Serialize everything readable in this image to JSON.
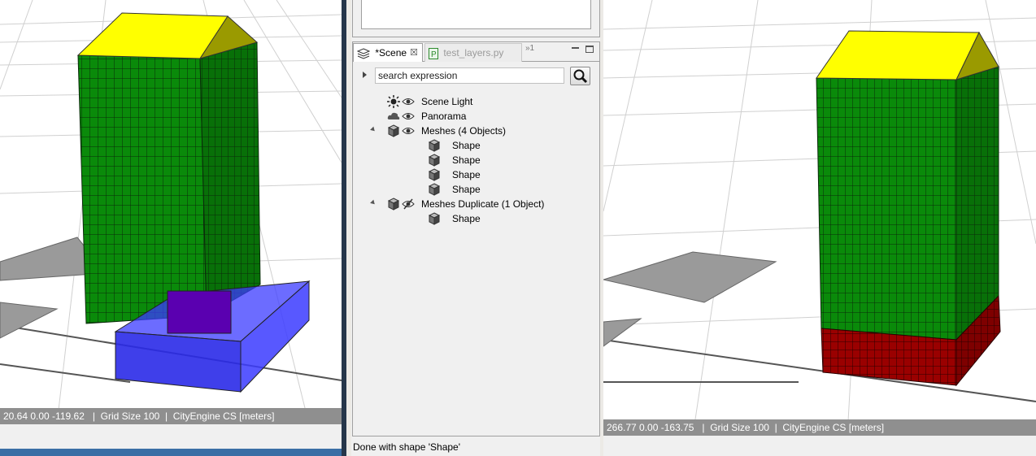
{
  "left_viewport": {
    "status_text": "20.64 0.00 -119.62   |  Grid Size 100  |  CityEngine CS [meters]"
  },
  "right_viewport": {
    "status_text": "266.77 0.00 -163.75   |  Grid Size 100  |  CityEngine CS [meters]"
  },
  "scene_panel": {
    "tabs": [
      {
        "label": "*Scene",
        "icon": "layers-icon",
        "active": true
      },
      {
        "label": "test_layers.py",
        "icon": "python-file-icon",
        "active": false
      }
    ],
    "overflow_label": "»1",
    "search": {
      "placeholder": "search expression",
      "value": "search expression"
    },
    "tree": [
      {
        "label": "Scene Light",
        "icon": "sun-icon",
        "visibility_icon": "eye-icon",
        "level": 0,
        "expandable": false
      },
      {
        "label": "Panorama",
        "icon": "cloud-icon",
        "visibility_icon": "eye-icon",
        "level": 0,
        "expandable": false
      },
      {
        "label": "Meshes (4 Objects)",
        "icon": "mesh-layer-icon",
        "visibility_icon": "eye-icon",
        "level": 0,
        "expandable": true,
        "expanded": true
      },
      {
        "label": "Shape",
        "icon": "cube-icon",
        "level": 1
      },
      {
        "label": "Shape",
        "icon": "cube-icon",
        "level": 1
      },
      {
        "label": "Shape",
        "icon": "cube-icon",
        "level": 1
      },
      {
        "label": "Shape",
        "icon": "cube-icon",
        "level": 1
      },
      {
        "label": "Meshes Duplicate (1 Object)",
        "icon": "mesh-layer-icon",
        "visibility_icon": "eye-hidden-icon",
        "level": 0,
        "expandable": true,
        "expanded": true
      },
      {
        "label": "Shape",
        "icon": "cube-icon",
        "level": 1
      }
    ]
  },
  "status_bar": {
    "message": "Done with shape 'Shape'"
  },
  "colors": {
    "building_green": "#0a8a0a",
    "roof_yellow": "#ffff00",
    "roof_side": "#9a9a00",
    "base_red": "#9a0000",
    "blue_box": "#2a2ae8",
    "ground_patch": "#9a9a9a",
    "viewport_status_bg": "#8f8f8f"
  }
}
